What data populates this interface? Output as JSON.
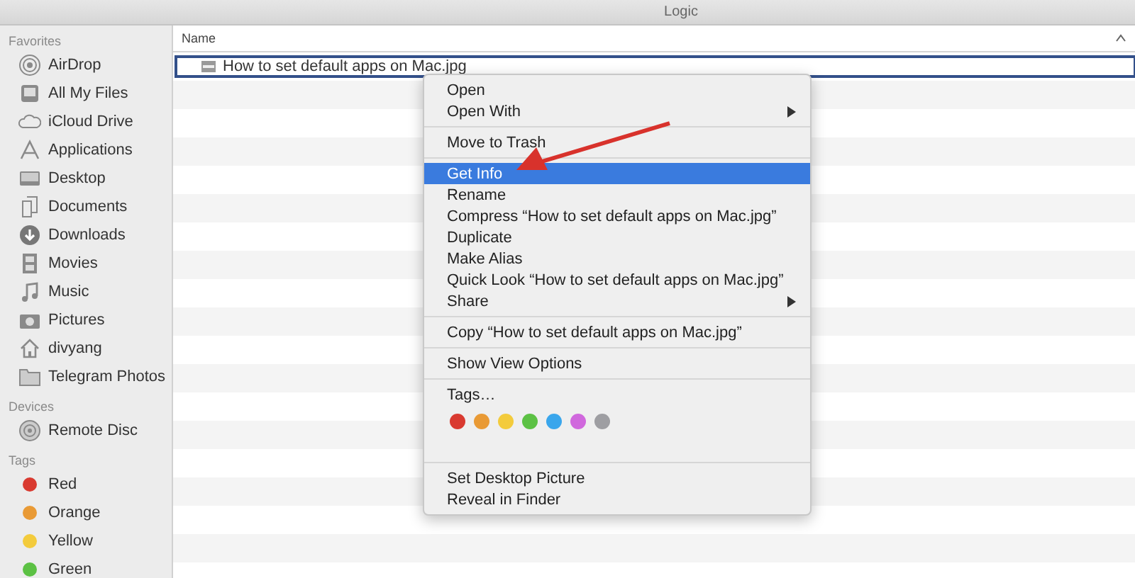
{
  "window": {
    "title": "Logic"
  },
  "sidebar": {
    "sections": [
      {
        "title": "Favorites",
        "items": [
          {
            "label": "AirDrop"
          },
          {
            "label": "All My Files"
          },
          {
            "label": "iCloud Drive"
          },
          {
            "label": "Applications"
          },
          {
            "label": "Desktop"
          },
          {
            "label": "Documents"
          },
          {
            "label": "Downloads"
          },
          {
            "label": "Movies"
          },
          {
            "label": "Music"
          },
          {
            "label": "Pictures"
          },
          {
            "label": "divyang"
          },
          {
            "label": "Telegram Photos"
          }
        ]
      },
      {
        "title": "Devices",
        "items": [
          {
            "label": "Remote Disc"
          }
        ]
      },
      {
        "title": "Tags",
        "items": [
          {
            "label": "Red",
            "color": "#d93a30"
          },
          {
            "label": "Orange",
            "color": "#e99a35"
          },
          {
            "label": "Yellow",
            "color": "#f3cb3c"
          },
          {
            "label": "Green",
            "color": "#5cc144"
          }
        ]
      }
    ]
  },
  "table": {
    "columns": [
      {
        "label": "Name"
      }
    ],
    "rows": [
      {
        "name": "How to set default apps on Mac.jpg",
        "selected": true
      }
    ]
  },
  "context_menu": {
    "items": [
      {
        "kind": "item",
        "label": "Open",
        "submenu": false,
        "selected": false
      },
      {
        "kind": "item",
        "label": "Open With",
        "submenu": true,
        "selected": false
      },
      {
        "kind": "separator"
      },
      {
        "kind": "item",
        "label": "Move to Trash",
        "submenu": false,
        "selected": false
      },
      {
        "kind": "separator"
      },
      {
        "kind": "item",
        "label": "Get Info",
        "submenu": false,
        "selected": true
      },
      {
        "kind": "item",
        "label": "Rename",
        "submenu": false,
        "selected": false
      },
      {
        "kind": "item",
        "label": "Compress “How to set default apps on Mac.jpg”",
        "submenu": false,
        "selected": false
      },
      {
        "kind": "item",
        "label": "Duplicate",
        "submenu": false,
        "selected": false
      },
      {
        "kind": "item",
        "label": "Make Alias",
        "submenu": false,
        "selected": false
      },
      {
        "kind": "item",
        "label": "Quick Look “How to set default apps on Mac.jpg”",
        "submenu": false,
        "selected": false
      },
      {
        "kind": "item",
        "label": "Share",
        "submenu": true,
        "selected": false
      },
      {
        "kind": "separator"
      },
      {
        "kind": "item",
        "label": "Copy “How to set default apps on Mac.jpg”",
        "submenu": false,
        "selected": false
      },
      {
        "kind": "separator"
      },
      {
        "kind": "item",
        "label": "Show View Options",
        "submenu": false,
        "selected": false
      },
      {
        "kind": "separator"
      },
      {
        "kind": "item",
        "label": "Tags…",
        "submenu": false,
        "selected": false
      },
      {
        "kind": "colors",
        "colors": [
          {
            "color": "#d93a30"
          },
          {
            "color": "#e99a35"
          },
          {
            "color": "#f3cb3c"
          },
          {
            "color": "#5cc144"
          },
          {
            "color": "#3aa6ec"
          },
          {
            "color": "#d068dd"
          },
          {
            "color": "#9e9ea2"
          }
        ]
      },
      {
        "kind": "separator"
      },
      {
        "kind": "item",
        "label": "Set Desktop Picture",
        "submenu": false,
        "selected": false
      },
      {
        "kind": "item",
        "label": "Reveal in Finder",
        "submenu": false,
        "selected": false
      }
    ]
  }
}
